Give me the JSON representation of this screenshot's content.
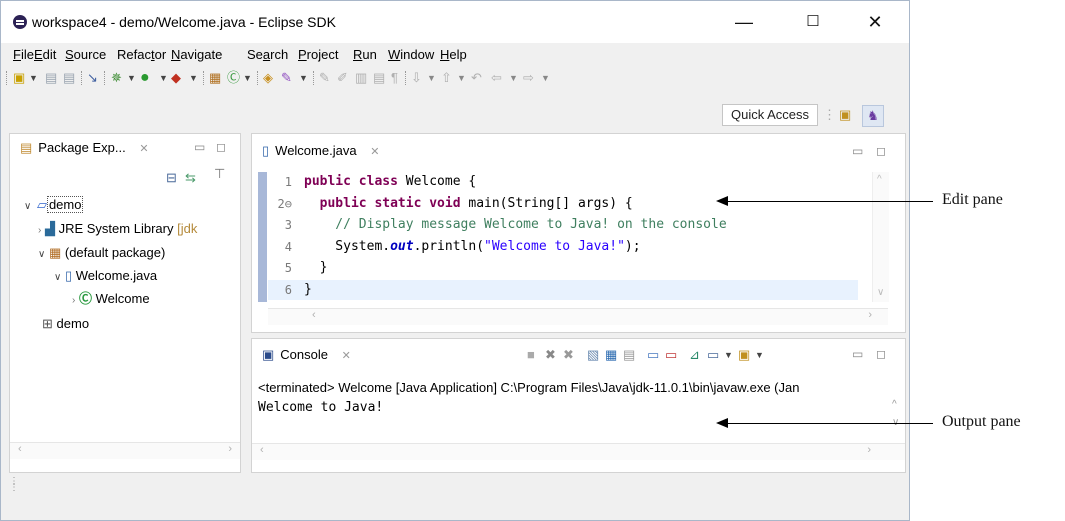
{
  "window": {
    "title": "workspace4 - demo/Welcome.java - Eclipse SDK",
    "minimize": "—",
    "maximize": "☐",
    "close": "✕"
  },
  "menu": [
    {
      "key": "F",
      "rest": "ile"
    },
    {
      "key": "E",
      "rest": "dit"
    },
    {
      "key": "S",
      "rest": "ource"
    },
    {
      "pre": "Refac",
      "key": "t",
      "rest": "or"
    },
    {
      "key": "N",
      "rest": "avigate"
    },
    {
      "pre": "Se",
      "key": "a",
      "rest": "rch"
    },
    {
      "key": "P",
      "rest": "roject"
    },
    {
      "key": "R",
      "rest": "un"
    },
    {
      "key": "W",
      "rest": "indow"
    },
    {
      "key": "H",
      "rest": "elp"
    }
  ],
  "quick_access": "Quick Access",
  "package_explorer": {
    "tab": "Package Exp...",
    "tree": {
      "project": "demo",
      "jre_label": "JRE System Library",
      "jre_suffix": "[jdk",
      "default_package": "(default package)",
      "file": "Welcome.java",
      "class": "Welcome",
      "folder": "demo"
    }
  },
  "editor": {
    "tab": "Welcome.java",
    "lines": [
      {
        "num": "1",
        "tokens": [
          {
            "t": "public class ",
            "c": "kw"
          },
          {
            "t": "Welcome ",
            "c": ""
          },
          {
            "t": "{",
            "c": ""
          }
        ]
      },
      {
        "num": "2⊖",
        "tokens": [
          {
            "t": "  public static void ",
            "c": "kw"
          },
          {
            "t": "main(String[] ",
            "c": ""
          },
          {
            "t": "args",
            "c": ""
          },
          {
            "t": ") {",
            "c": ""
          }
        ]
      },
      {
        "num": "3",
        "tokens": [
          {
            "t": "    // Display message Welcome to Java! on the console",
            "c": "cmt"
          }
        ]
      },
      {
        "num": "4",
        "tokens": [
          {
            "t": "    System.",
            "c": ""
          },
          {
            "t": "out",
            "c": "fld"
          },
          {
            "t": ".println(",
            "c": ""
          },
          {
            "t": "\"Welcome to Java!\"",
            "c": "str"
          },
          {
            "t": ");",
            "c": ""
          }
        ]
      },
      {
        "num": "5",
        "tokens": [
          {
            "t": "  }",
            "c": ""
          }
        ]
      },
      {
        "num": "6",
        "tokens": [
          {
            "t": "}",
            "c": ""
          }
        ]
      }
    ]
  },
  "console": {
    "tab": "Console",
    "status": "<terminated> Welcome [Java Application] C:\\Program Files\\Java\\jdk-11.0.1\\bin\\javaw.exe (Jan",
    "output": "Welcome to Java!"
  },
  "callouts": {
    "edit": "Edit pane",
    "output": "Output pane"
  },
  "colors": {
    "keyword": "#7f0055",
    "comment": "#3f7f5f",
    "string": "#2a00ff",
    "field": "#0000c0",
    "current_line": "#e8f2fe",
    "ruler": "#a8b8d8"
  }
}
